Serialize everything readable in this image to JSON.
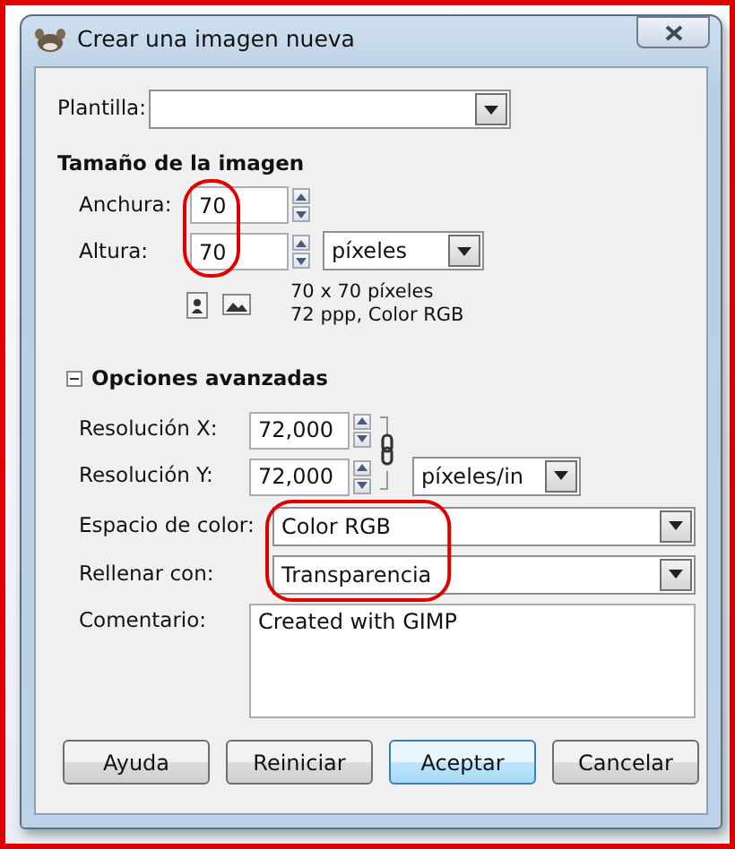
{
  "window": {
    "title": "Crear una imagen nueva"
  },
  "template": {
    "label": "Plantilla:"
  },
  "image_size": {
    "heading": "Tamaño de la imagen",
    "width": {
      "label": "Anchura:",
      "value": "70"
    },
    "height": {
      "label": "Altura:",
      "value": "70"
    },
    "unit": "píxeles",
    "summary": [
      "70 x 70 píxeles",
      "72 ppp, Color RGB"
    ]
  },
  "advanced": {
    "label": "Opciones avanzadas",
    "expanded": true,
    "res_x": {
      "label": "Resolución X:",
      "value": "72,000"
    },
    "res_y": {
      "label": "Resolución Y:",
      "value": "72,000"
    },
    "res_unit": "píxeles/in",
    "color_space": {
      "label": "Espacio de color:",
      "value": "Color RGB"
    },
    "fill": {
      "label": "Rellenar con:",
      "value": "Transparencia"
    },
    "comment": {
      "label": "Comentario:",
      "value": "Created with GIMP"
    }
  },
  "buttons": [
    {
      "label": "Ayuda",
      "focused": false
    },
    {
      "label": "Reiniciar",
      "focused": false
    },
    {
      "label": "Aceptar",
      "focused": true
    },
    {
      "label": "Cancelar",
      "focused": false
    }
  ],
  "annotations": [
    {
      "kind": "circle"
    },
    {
      "kind": "circle"
    }
  ]
}
